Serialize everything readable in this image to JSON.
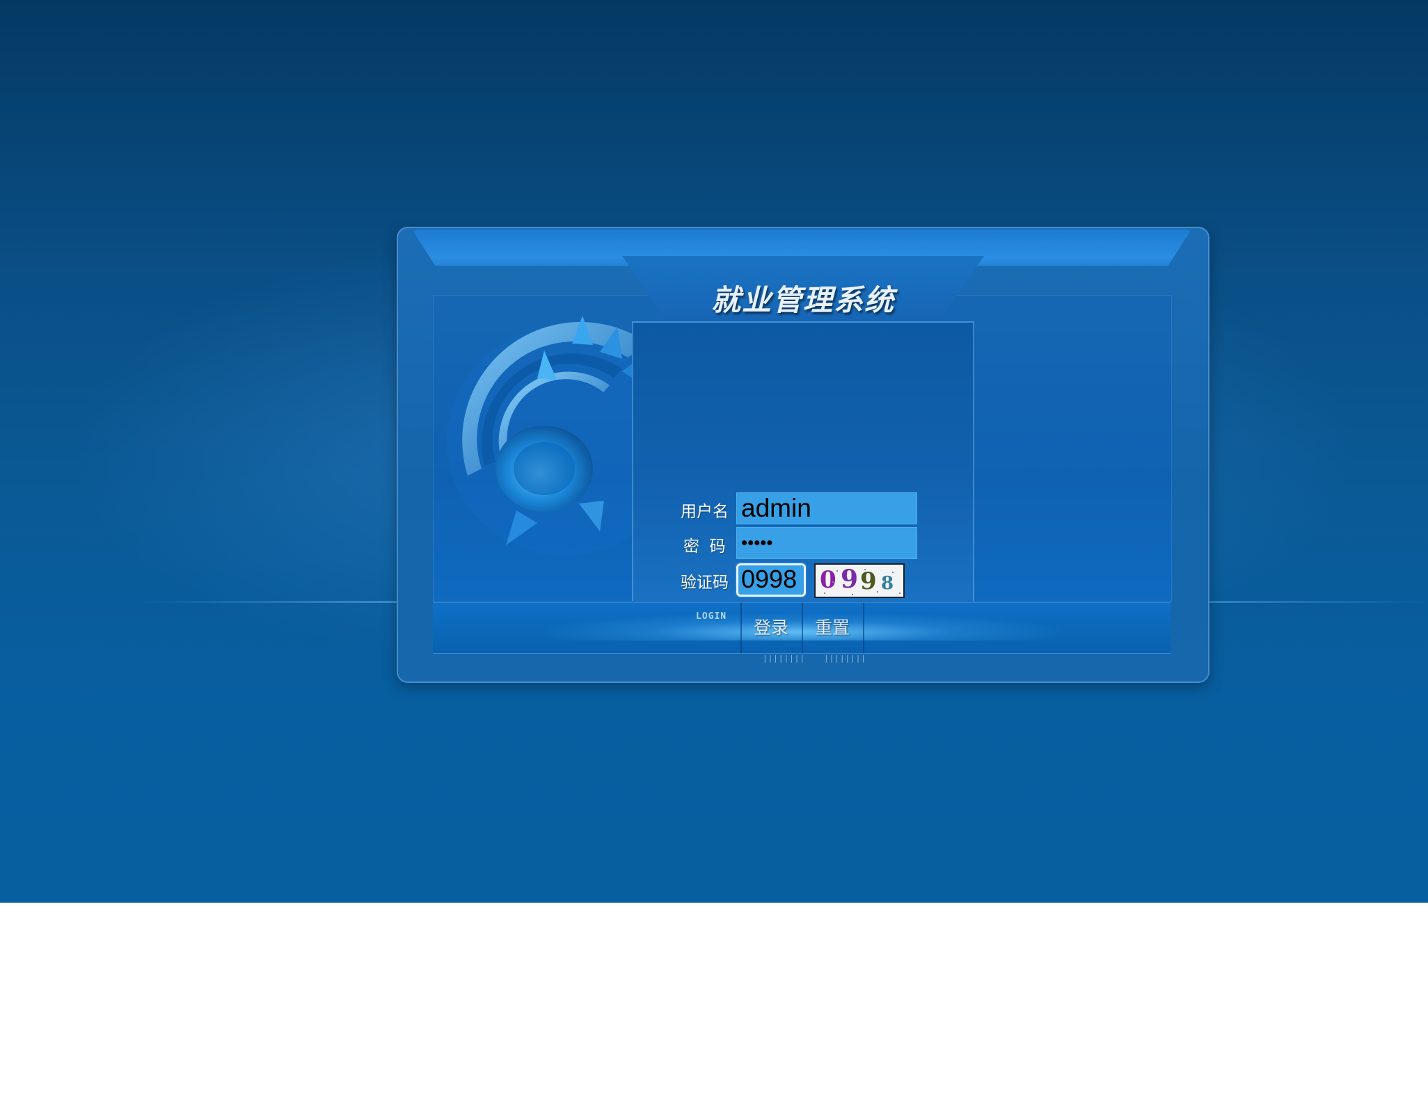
{
  "app": {
    "title": "就业管理系统"
  },
  "form": {
    "username_label": "用户名",
    "username_value": "admin",
    "password_label": "密  码",
    "password_value": "•••••",
    "captcha_label": "验证码",
    "captcha_value": "0998",
    "captcha_image_text": [
      "0",
      "9",
      "9",
      "8"
    ]
  },
  "actions": {
    "login_caption": "LOGIN",
    "login_label": "登录",
    "reset_label": "重置",
    "grip_glyph": "||||||||"
  },
  "colors": {
    "background": "#0a4f86",
    "input_fill": "#37a0e6",
    "captcha_digits": [
      "#8b1fa8",
      "#7b2aa8",
      "#4d5a1f",
      "#2f7f9a"
    ]
  }
}
